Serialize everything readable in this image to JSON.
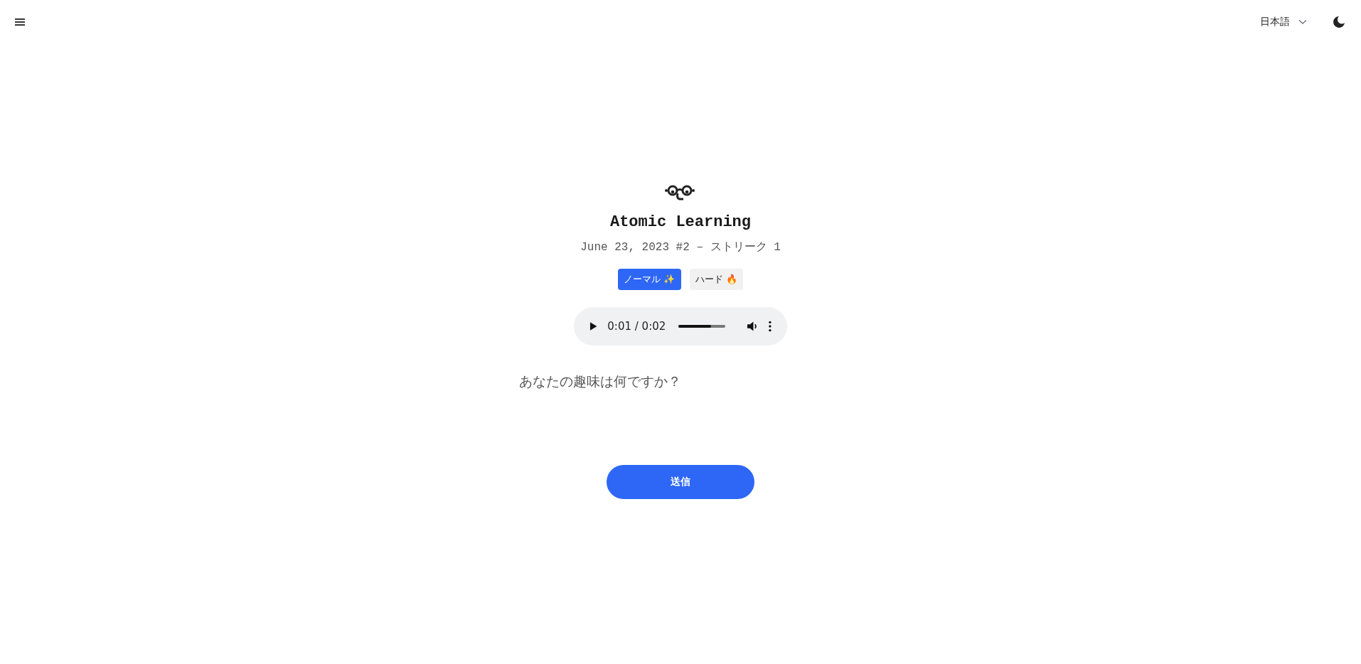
{
  "header": {
    "language": "日本語"
  },
  "app": {
    "title": "Atomic Learning",
    "subtitle": "June 23, 2023 #2 – ストリーク 1"
  },
  "modes": [
    {
      "label": "ノーマル ✨",
      "selected": true
    },
    {
      "label": "ハード 🔥",
      "selected": false
    }
  ],
  "audio": {
    "time": "0:01 / 0:02",
    "level": 0.7
  },
  "question": "あなたの趣味は何ですか？",
  "submit": "送信"
}
